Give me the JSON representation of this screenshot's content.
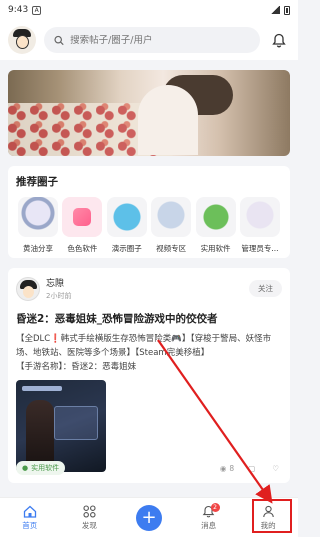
{
  "status": {
    "time": "9:43",
    "icon_a": "A"
  },
  "header": {
    "search_placeholder": "搜索帖子/圈子/用户"
  },
  "circles": {
    "title": "推荐圈子",
    "items": [
      {
        "label": "黄油分享"
      },
      {
        "label": "色色软件"
      },
      {
        "label": "演示圈子"
      },
      {
        "label": "视频专区"
      },
      {
        "label": "实用软件"
      },
      {
        "label": "管理员专..."
      }
    ]
  },
  "post": {
    "author": "忘隙",
    "time": "2小时前",
    "follow_label": "关注",
    "title": "昏迷2：恶毒姐妹_恐怖冒险游戏中的佼佼者",
    "body_line1": "【全DLC❗韩式手绘横版生存恐怖冒险类🎮】【穿梭于警局、妖怪市场、地铁站、医院等多个场景】【Steam完美移植】",
    "body_line2": "【手游名称】：昏迷2：恶毒姐妹",
    "tag": "实用软件",
    "views": "8",
    "comments": "",
    "likes": ""
  },
  "tabbar": {
    "home": "首页",
    "discover": "发现",
    "publish": "+",
    "messages": "消息",
    "messages_badge": "2",
    "mine": "我的"
  },
  "colors": {
    "accent": "#3d7cf0",
    "highlight_red": "#e01f1f"
  }
}
